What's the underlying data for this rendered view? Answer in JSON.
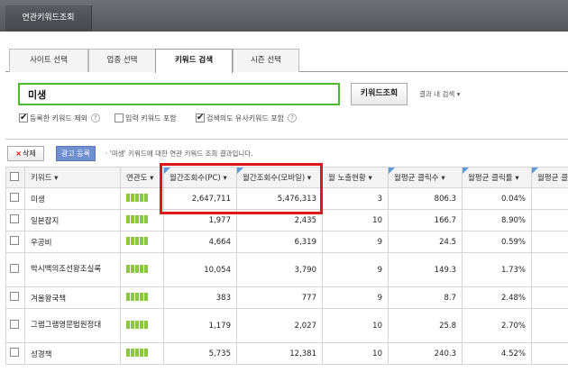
{
  "window": {
    "title": "연관키워드조회"
  },
  "tabs": [
    {
      "label": "사이트 선택",
      "active": false
    },
    {
      "label": "업종 선택",
      "active": false
    },
    {
      "label": "키워드 검색",
      "active": true
    },
    {
      "label": "시즌 선택",
      "active": false
    }
  ],
  "search": {
    "value": "미생",
    "button": "키워드조회",
    "in_result": "결과 내 검색"
  },
  "options": [
    {
      "label": "등록한 키워드 제외",
      "checked": true,
      "help": "?"
    },
    {
      "label": "입력 키워드 포함",
      "checked": false,
      "help": ""
    },
    {
      "label": "검색의도 유사키워드 포함",
      "checked": true,
      "help": "?"
    }
  ],
  "actions": {
    "delete": "삭제",
    "ad_register": "광고 등록",
    "message": "'미생' 키워드에 대한 연관 키워드 조회 결과입니다."
  },
  "columns": [
    "키워드",
    "연관도",
    "월간조회수(PC)",
    "월간조회수(모바일)",
    "월 노출현황",
    "월평균 클릭수",
    "월평균 클릭률",
    "월평균 클릭"
  ],
  "rows": [
    {
      "keyword": "미생",
      "pc": "2,647,711",
      "mobile": "5,476,313",
      "exposure": "3",
      "clicks": "806.3",
      "ctr": "0.04%",
      "tall": false
    },
    {
      "keyword": "일본잡지",
      "pc": "1,977",
      "mobile": "2,435",
      "exposure": "10",
      "clicks": "166.7",
      "ctr": "8.90%",
      "tall": false
    },
    {
      "keyword": "우공비",
      "pc": "4,664",
      "mobile": "6,319",
      "exposure": "9",
      "clicks": "24.5",
      "ctr": "0.59%",
      "tall": false
    },
    {
      "keyword": "박시백의조선왕조실록",
      "pc": "10,054",
      "mobile": "3,790",
      "exposure": "9",
      "clicks": "149.3",
      "ctr": "1.73%",
      "tall": true
    },
    {
      "keyword": "겨울왕국책",
      "pc": "383",
      "mobile": "777",
      "exposure": "9",
      "clicks": "8.7",
      "ctr": "2.48%",
      "tall": false
    },
    {
      "keyword": "그램그램영문법원정대",
      "pc": "1,179",
      "mobile": "2,027",
      "exposure": "10",
      "clicks": "25.8",
      "ctr": "2.70%",
      "tall": true
    },
    {
      "keyword": "성경책",
      "pc": "5,735",
      "mobile": "12,381",
      "exposure": "10",
      "clicks": "240.3",
      "ctr": "4.52%",
      "tall": false
    }
  ],
  "colors": {
    "accent_green": "#4dbb2e",
    "highlight_red": "#e0161b",
    "ad_button": "#6f8fd0",
    "header_marker": "#5e9ad6",
    "relevance_bar": "#8dc63f"
  }
}
